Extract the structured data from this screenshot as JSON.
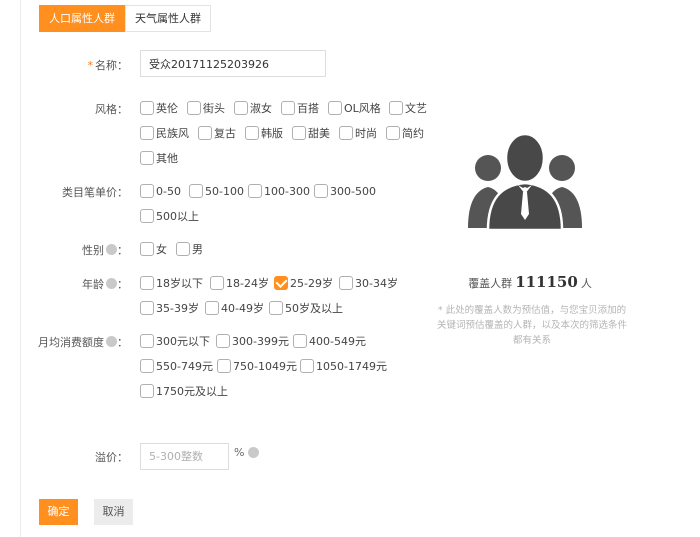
{
  "tabs": [
    {
      "label": "人口属性人群",
      "active": true
    },
    {
      "label": "天气属性人群",
      "active": false
    }
  ],
  "form": {
    "name": {
      "required_mark": "*",
      "label": "名称：",
      "value": "受众20171125203926"
    },
    "style": {
      "label": "风格：",
      "options": [
        "英伦",
        "街头",
        "淑女",
        "百搭",
        "OL风格",
        "文艺",
        "民族风",
        "复古",
        "韩版",
        "甜美",
        "时尚",
        "简约",
        "其他"
      ]
    },
    "price": {
      "label": "类目笔单价：",
      "options": [
        "0-50",
        "50-100",
        "100-300",
        "300-500",
        "500以上"
      ]
    },
    "gender": {
      "label": "性别",
      "colon": "：",
      "options": [
        "女",
        "男"
      ]
    },
    "age": {
      "label": "年龄",
      "colon": "：",
      "options": [
        "18岁以下",
        "18-24岁",
        "25-29岁",
        "30-34岁",
        "35-39岁",
        "40-49岁",
        "50岁及以上"
      ],
      "checked": "25-29岁"
    },
    "spend": {
      "label": "月均消费额度",
      "colon": "：",
      "options": [
        "300元以下",
        "300-399元",
        "400-549元",
        "550-749元",
        "750-1049元",
        "1050-1749元",
        "1750元及以上"
      ]
    },
    "bid": {
      "label": "溢价：",
      "placeholder": "5-300整数",
      "unit": "%"
    }
  },
  "buttons": {
    "ok": "确定",
    "cancel": "取消"
  },
  "coverage": {
    "prefix": "覆盖人群",
    "count": "111150",
    "suffix": "人",
    "note_line1": "* 此处的覆盖人数为预估值，与您宝贝添加的",
    "note_line2": "关键词预估覆盖的人群，以及本次的筛选条件",
    "note_line3": "都有关系"
  },
  "colors": {
    "accent": "#ff8f1f",
    "avatar": "#555555"
  },
  "icons": {
    "help": "question-circle-icon",
    "avatar": "user-group-icon"
  }
}
